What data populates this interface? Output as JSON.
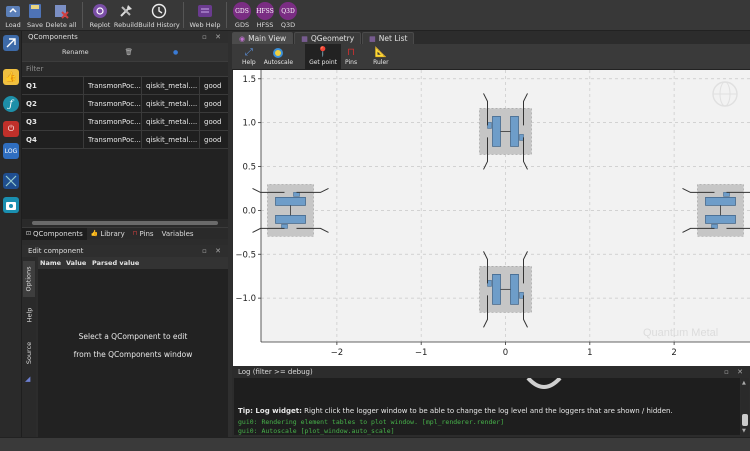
{
  "toolbar": {
    "buttons": [
      {
        "label": "Load",
        "icon": "load-icon"
      },
      {
        "label": "Save",
        "icon": "save-icon"
      },
      {
        "label": "Delete all",
        "icon": "delete-all-icon"
      },
      {
        "label": "Replot",
        "icon": "replot-icon"
      },
      {
        "label": "Rebuild",
        "icon": "rebuild-icon"
      },
      {
        "label": "Build History",
        "icon": "build-history-icon"
      },
      {
        "label": "Web Help",
        "icon": "web-help-icon"
      },
      {
        "label": "GDS",
        "icon": "GDS"
      },
      {
        "label": "HFSS",
        "icon": "HFSS"
      },
      {
        "label": "Q3D",
        "icon": "Q3D"
      }
    ]
  },
  "qcomponents": {
    "title": "QComponents",
    "rename_label": "Rename",
    "filter_placeholder": "Filter",
    "rows": [
      {
        "name": "Q1",
        "class": "TransmonPoc...",
        "module": "qiskit_metal....",
        "status": "good"
      },
      {
        "name": "Q2",
        "class": "TransmonPoc...",
        "module": "qiskit_metal....",
        "status": "good"
      },
      {
        "name": "Q3",
        "class": "TransmonPoc...",
        "module": "qiskit_metal....",
        "status": "good"
      },
      {
        "name": "Q4",
        "class": "TransmonPoc...",
        "module": "qiskit_metal....",
        "status": "good"
      }
    ],
    "tabs": [
      "QComponents",
      "Library",
      "Pins",
      "Variables"
    ]
  },
  "edit_component": {
    "title": "Edit component",
    "columns": [
      "Name",
      "Value",
      "Parsed value"
    ],
    "vertical_tabs": [
      "Options",
      "Help",
      "Source"
    ],
    "message_line1": "Select a QComponent to edit",
    "message_line2": "from the QComponents window"
  },
  "main_view": {
    "tabs": [
      "Main View",
      "QGeometry",
      "Net List"
    ],
    "plot_buttons": [
      {
        "label": "Help",
        "icon": "help-icon"
      },
      {
        "label": "Autoscale",
        "icon": "autoscale-icon"
      },
      {
        "label": "Get point",
        "icon": "get-point-icon"
      },
      {
        "label": "Pins",
        "icon": "pins-icon"
      },
      {
        "label": "Ruler",
        "icon": "ruler-icon"
      }
    ],
    "watermark": "Quantum Metal"
  },
  "chart_data": {
    "type": "scatter",
    "xlim": [
      -2.9,
      2.9
    ],
    "ylim": [
      -1.5,
      1.6
    ],
    "x_ticks": [
      "−2",
      "−1",
      "0",
      "1",
      "2"
    ],
    "y_ticks": [
      "1.5",
      "1.0",
      "0.5",
      "0.0",
      "−0.5",
      "−1.0"
    ],
    "x_tick_values": [
      -2,
      -1,
      0,
      1,
      2
    ],
    "y_tick_values": [
      1.5,
      1.0,
      0.5,
      0.0,
      -0.5,
      -1.0
    ],
    "grid": true,
    "components": [
      {
        "name": "Q1",
        "x": 2.55,
        "y": 0.0,
        "orientation": "horizontal"
      },
      {
        "name": "Q2",
        "x": 0.0,
        "y": 0.9,
        "orientation": "vertical"
      },
      {
        "name": "Q3",
        "x": -2.55,
        "y": 0.0,
        "orientation": "horizontal"
      },
      {
        "name": "Q4",
        "x": 0.0,
        "y": -0.9,
        "orientation": "vertical"
      }
    ]
  },
  "log": {
    "title": "Log  (filter >= debug)",
    "tip_bold": "Tip: Log widget:",
    "tip_text": " Right click the logger window to be able to change the log level and the loggers that are shown / hidden.",
    "lines": [
      "gui0: Rendering element tables to plot window. [mpl_renderer.render]",
      "gui0: Autoscale [plot_window.auto_scale]"
    ]
  }
}
